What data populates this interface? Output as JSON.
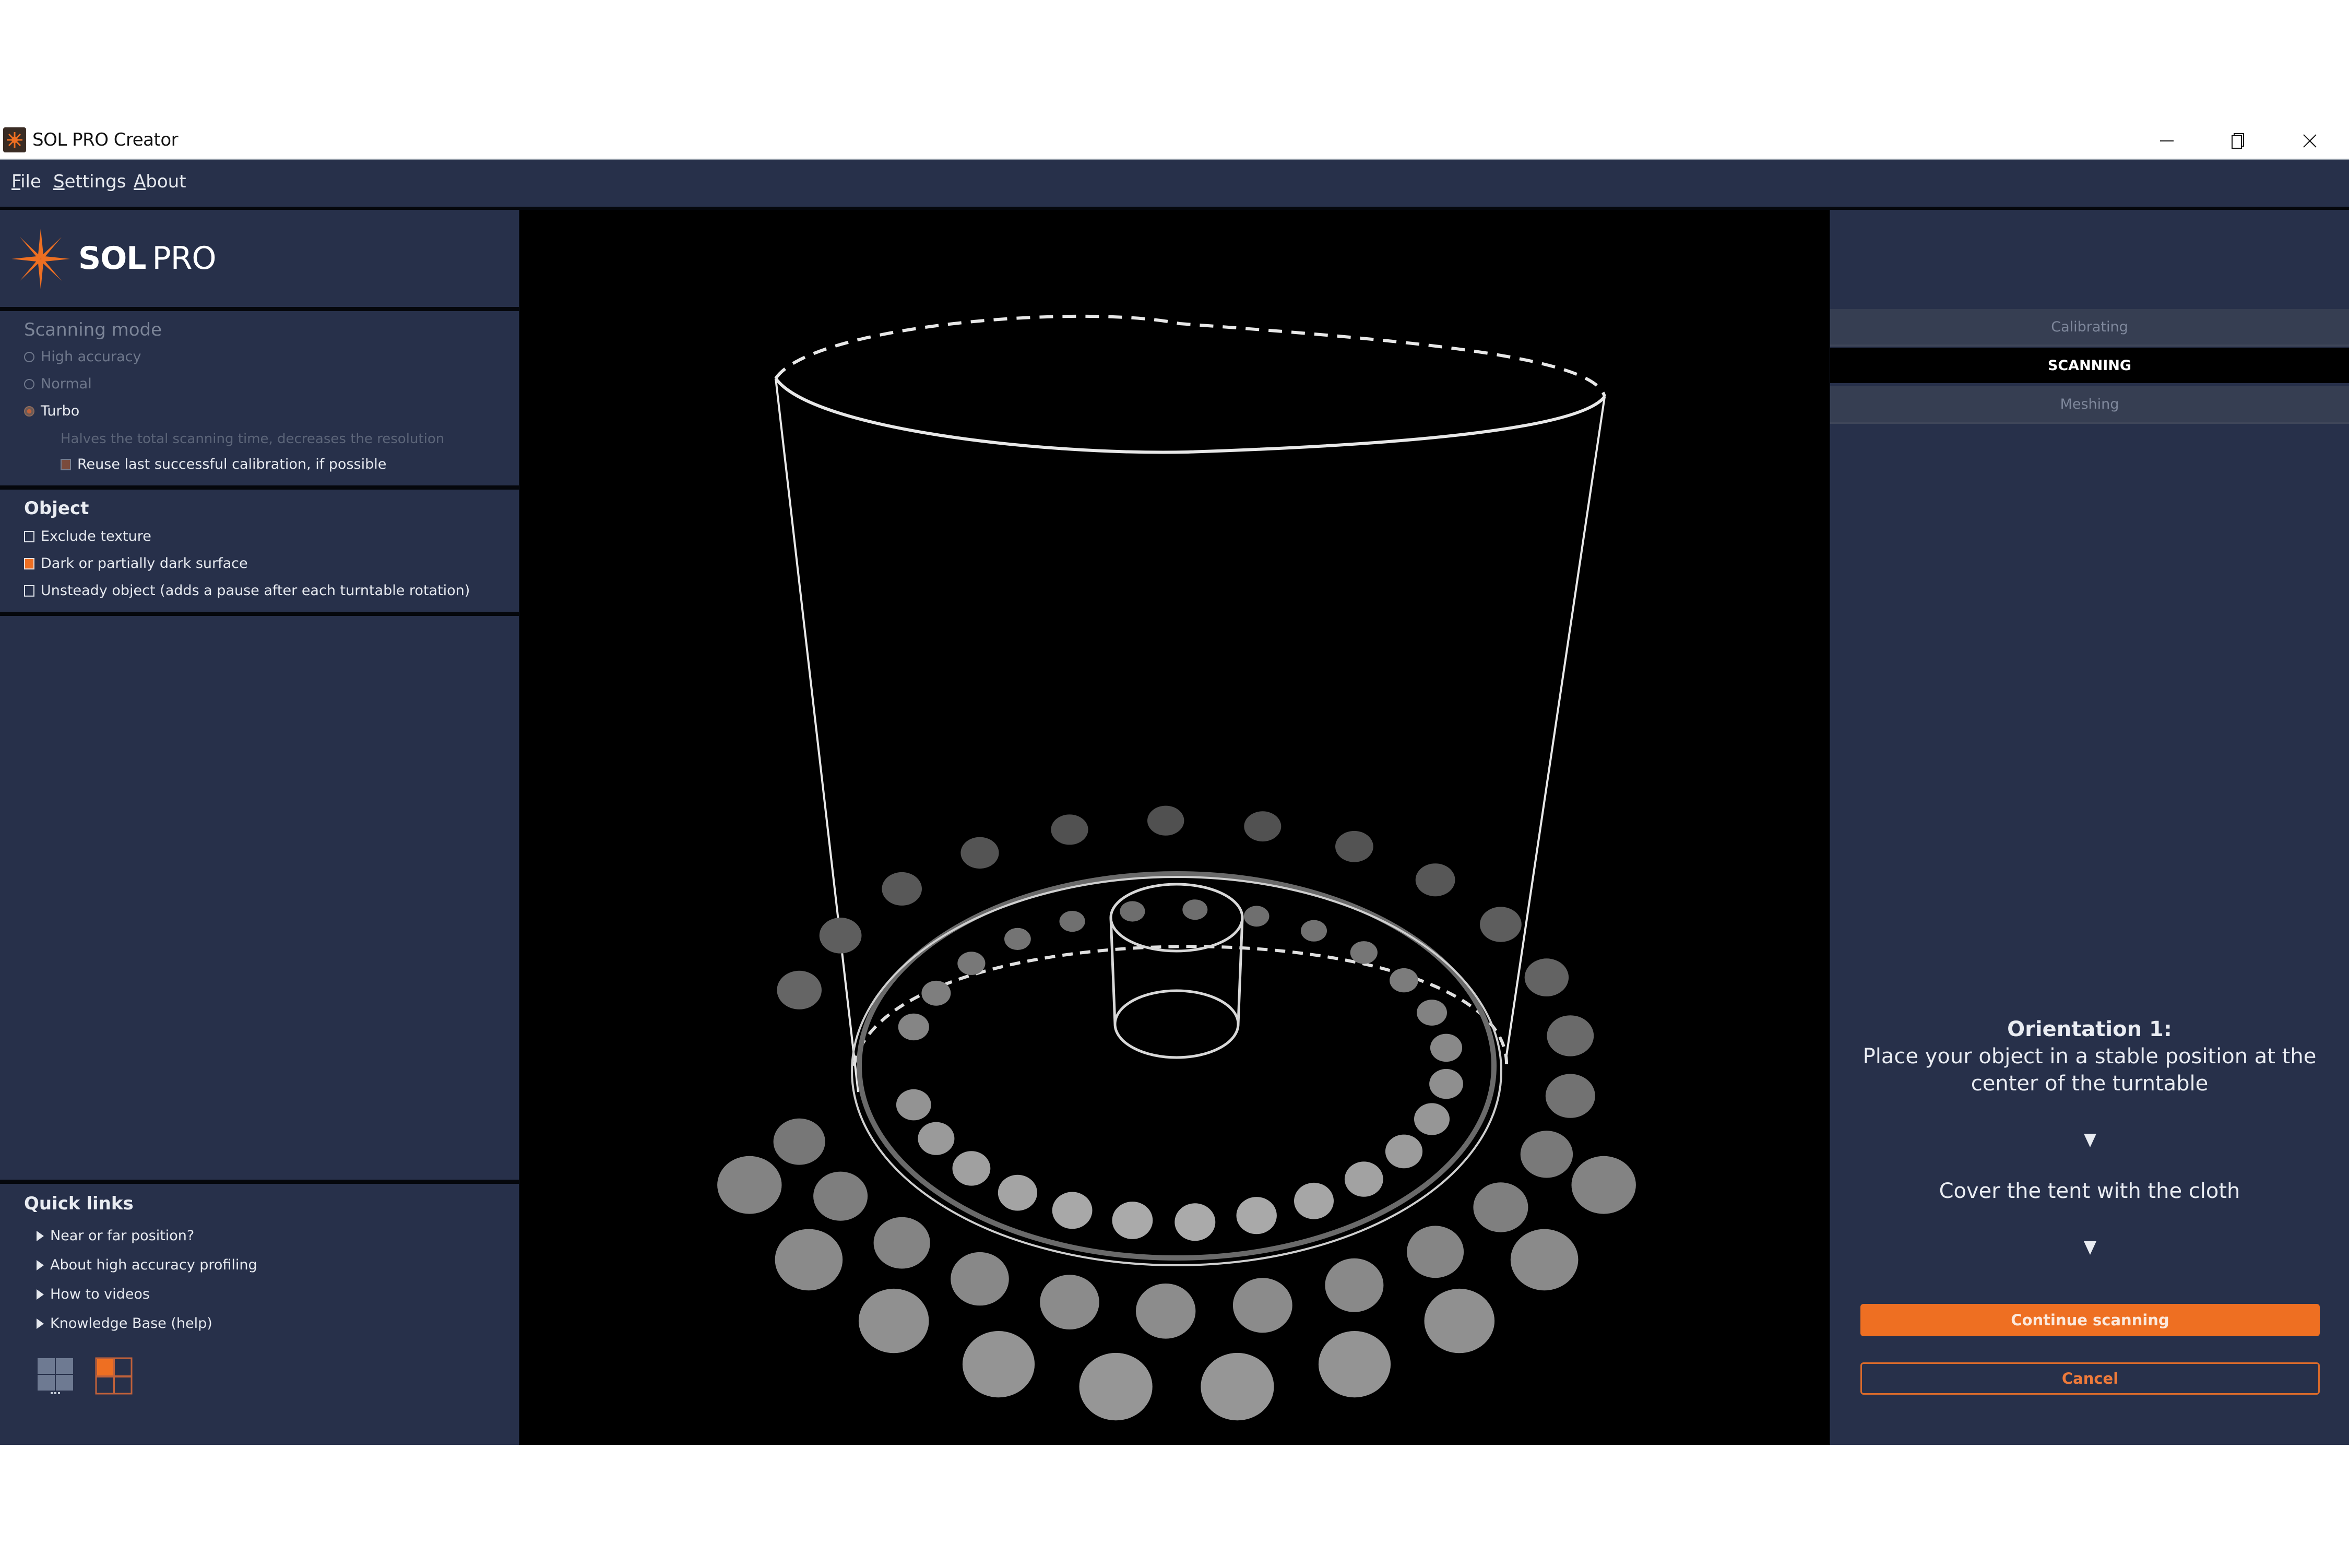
{
  "window": {
    "title": "SOL PRO Creator",
    "controls": {
      "minimize": "minimize-icon",
      "restore": "restore-icon",
      "close": "close-icon"
    }
  },
  "menu": [
    {
      "label": "File",
      "mnemonic": "F",
      "rest": "ile"
    },
    {
      "label": "Settings",
      "mnemonic": "S",
      "rest": "ettings"
    },
    {
      "label": "About",
      "mnemonic": "A",
      "rest": "bout"
    }
  ],
  "brand": {
    "strong": "SOL",
    "light": "PRO",
    "accent": "#ee6f22"
  },
  "scanning_mode": {
    "title": "Scanning mode",
    "options": [
      {
        "label": "High accuracy",
        "selected": false
      },
      {
        "label": "Normal",
        "selected": false
      },
      {
        "label": "Turbo",
        "selected": true
      }
    ],
    "hint": "Halves the total scanning time, decreases the resolution",
    "reuse_calibration": {
      "label": "Reuse last successful calibration, if possible",
      "checked": true,
      "enabled": false
    }
  },
  "object": {
    "title": "Object",
    "options": [
      {
        "label": "Exclude texture",
        "checked": false
      },
      {
        "label": "Dark or partially dark surface",
        "checked": true
      },
      {
        "label": "Unsteady object (adds a pause after each turntable rotation)",
        "checked": false
      }
    ]
  },
  "quick_links": {
    "title": "Quick links",
    "items": [
      {
        "label": "Near or far position?"
      },
      {
        "label": "About high accuracy profiling"
      },
      {
        "label": "How to videos"
      },
      {
        "label": "Knowledge Base (help)"
      }
    ]
  },
  "layout_buttons": [
    {
      "name": "grid-layout-icon",
      "active": false
    },
    {
      "name": "split-layout-icon",
      "active": true
    }
  ],
  "steps": [
    {
      "label": "Calibrating",
      "state": "inactive"
    },
    {
      "label": "SCANNING",
      "state": "active"
    },
    {
      "label": "Meshing",
      "state": "inactive"
    }
  ],
  "instructions": {
    "heading": "Orientation 1:",
    "line1": "Place your object in a stable position at the center of the turntable",
    "line2": "Cover the tent with the cloth"
  },
  "actions": {
    "continue": "Continue scanning",
    "cancel": "Cancel"
  },
  "colors": {
    "panel": "#27304a",
    "accent": "#ee6f22",
    "viewport": "#000000"
  }
}
